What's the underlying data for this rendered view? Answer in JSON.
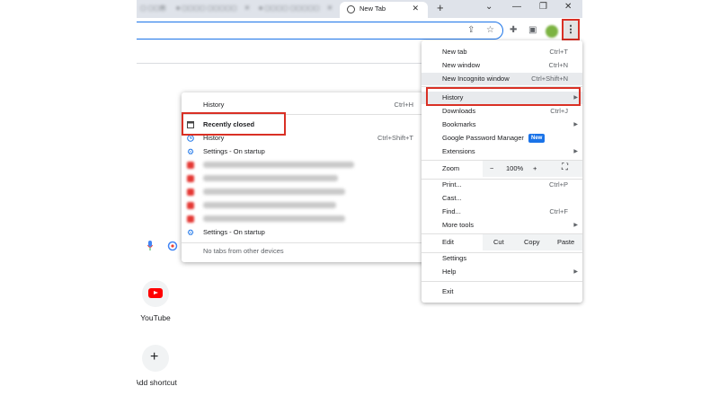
{
  "browser": {
    "active_tab": "New Tab",
    "window_controls": [
      "chevron-down",
      "minimize",
      "restore",
      "close"
    ]
  },
  "toolbar": {
    "icons": [
      "share-icon",
      "star-icon",
      "extensions-icon",
      "side-panel-icon",
      "profile-avatar",
      "kebab-menu-icon"
    ],
    "menu_button": "⋮"
  },
  "ntp": {
    "shortcuts": [
      {
        "label": "YouTube",
        "icon": "youtube-icon"
      },
      {
        "label": "Add shortcut",
        "icon": "plus-icon"
      }
    ]
  },
  "chrome_menu": {
    "items": [
      {
        "label": "New tab",
        "shortcut": "Ctrl+T"
      },
      {
        "label": "New window",
        "shortcut": "Ctrl+N"
      },
      {
        "label": "New Incognito window",
        "shortcut": "Ctrl+Shift+N"
      },
      {
        "label": "History",
        "submenu": true
      },
      {
        "label": "Downloads",
        "shortcut": "Ctrl+J"
      },
      {
        "label": "Bookmarks",
        "submenu": true
      },
      {
        "label": "Google Password Manager",
        "badge": "New"
      },
      {
        "label": "Extensions",
        "submenu": true
      },
      {
        "label": "Zoom",
        "minus": "−",
        "value": "100%",
        "plus": "+"
      },
      {
        "label": "Print...",
        "shortcut": "Ctrl+P"
      },
      {
        "label": "Cast..."
      },
      {
        "label": "Find...",
        "shortcut": "Ctrl+F"
      },
      {
        "label": "More tools",
        "submenu": true
      },
      {
        "label": "Edit",
        "cut": "Cut",
        "copy": "Copy",
        "paste": "Paste"
      },
      {
        "label": "Settings"
      },
      {
        "label": "Help",
        "submenu": true
      },
      {
        "label": "Exit"
      }
    ]
  },
  "history_submenu": {
    "header": {
      "label": "History",
      "shortcut": "Ctrl+H"
    },
    "recently_closed": "Recently closed",
    "history_item": {
      "label": "History",
      "shortcut": "Ctrl+Shift+T"
    },
    "settings_1": "Settings - On startup",
    "settings_2": "Settings - On startup",
    "no_tabs": "No tabs from other devices"
  },
  "colors": {
    "highlight": "#d93025",
    "accent": "#1a73e8",
    "menu_hover": "#e8eaed"
  }
}
